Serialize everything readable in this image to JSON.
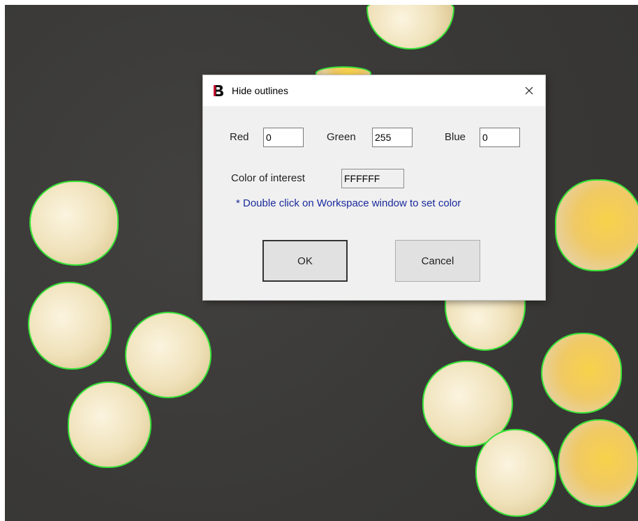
{
  "dialog": {
    "title": "Hide outlines",
    "close_symbol": "×",
    "red_label": "Red",
    "red_value": "0",
    "green_label": "Green",
    "green_value": "255",
    "blue_label": "Blue",
    "blue_value": "0",
    "color_of_interest_label": "Color of interest",
    "color_of_interest_value": "FFFFFF",
    "hint": "* Double click on Workspace window to set color",
    "ok_label": "OK",
    "cancel_label": "Cancel"
  },
  "icons": {
    "app": "app-logo-icon",
    "close": "close-icon"
  },
  "colors": {
    "outline": "#36e236",
    "workspace_bg": "#3b3a38",
    "dialog_bg": "#f0f0f0",
    "hint_text": "#1a2a9c",
    "app_icon_red": "#c8102e"
  }
}
